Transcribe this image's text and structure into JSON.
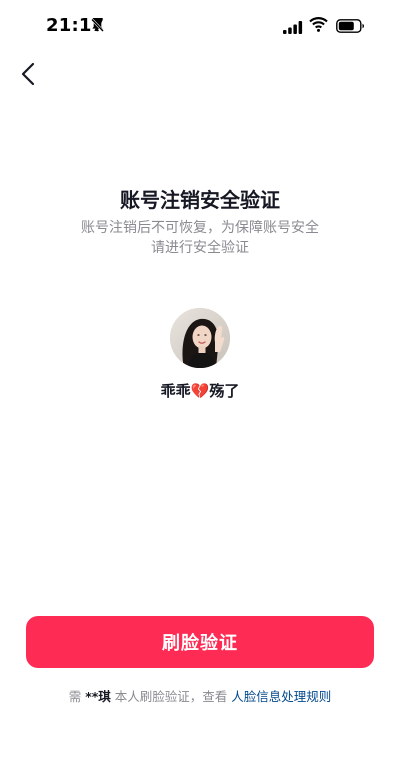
{
  "status_bar": {
    "time": "21:17",
    "icons": [
      "bell-slash-icon",
      "signal-icon",
      "wifi-icon",
      "battery-icon"
    ]
  },
  "nav": {
    "back_icon": "chevron-left-icon"
  },
  "main": {
    "title": "账号注销安全验证",
    "subtitle_line1": "账号注销后不可恢复，为保障账号安全",
    "subtitle_line2": "请进行安全验证",
    "username": "乖乖💔殇了"
  },
  "actions": {
    "face_verify_label": "刷脸验证"
  },
  "footer": {
    "prefix": "需 ",
    "masked_name": "**琪",
    "middle": " 本人刷脸验证，查看 ",
    "policy_link": "人脸信息处理规则"
  },
  "colors": {
    "primary": "#fe2c55",
    "link": "#04498d",
    "text": "#161823",
    "muted": "#8a8b91"
  }
}
